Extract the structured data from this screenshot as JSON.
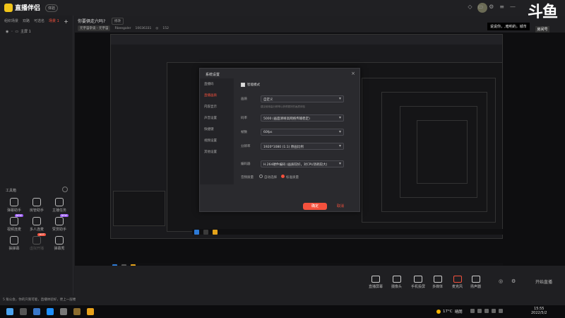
{
  "app": {
    "name": "直播伴侣",
    "version_badge": "体验"
  },
  "room": {
    "title": "你要俩走六吗?",
    "edit_label": "修改",
    "category": "元宇宙杂谈 - 元宇宙",
    "host": "Rbeegaler",
    "room_id": "10036331",
    "viewers": "152"
  },
  "left_tabs": [
    {
      "label": "组织场景"
    },
    {
      "label": "双路"
    },
    {
      "label": "可选名"
    },
    {
      "label": "场景 1"
    }
  ],
  "scene_item": "主屏 1",
  "tools": {
    "title": "工具箱",
    "items": [
      {
        "label": "弹幕助手",
        "badge": ""
      },
      {
        "label": "房管助手",
        "badge": ""
      },
      {
        "label": "主播任务",
        "badge": ""
      },
      {
        "label": "视频连麦",
        "badge": "NEW"
      },
      {
        "label": "多人连麦",
        "badge": ""
      },
      {
        "label": "赞赏助手",
        "badge": "NEW"
      },
      {
        "label": "抽弹幕",
        "badge": ""
      },
      {
        "label": "虚拟开播",
        "badge": "HOT"
      },
      {
        "label": "弹幕秀",
        "badge": ""
      }
    ]
  },
  "notice": "说说你，,暗响的，城市",
  "brand": {
    "logo_text": "斗鱼",
    "sub": "房间号",
    "number": "10036331"
  },
  "dialog": {
    "title": "系统设置",
    "nav": [
      {
        "label": "直播码"
      },
      {
        "label": "直播画质"
      },
      {
        "label": "内容显示"
      },
      {
        "label": "声音设置"
      },
      {
        "label": "快捷键"
      },
      {
        "label": "视频设置"
      },
      {
        "label": "其他设置"
      }
    ],
    "smart_mode": "智能模式",
    "rows": [
      {
        "label": "画质",
        "value": "自定义"
      },
      {
        "label": "码率",
        "value": "5000 (画面清晰高网络传输稳定)"
      },
      {
        "label": "帧数",
        "value": "60fps"
      },
      {
        "label": "分辨率",
        "value": "1920*1080 (1:1) 原画比例"
      },
      {
        "label": "编码器",
        "value": "H.264硬件编码 (画质较好，对CPU消耗较大)"
      }
    ],
    "hint": "建议使用高分辨率以获得更好的画质体验",
    "radio_label": "音频质量",
    "radio_options": [
      "自动选择",
      "标准质量"
    ],
    "ok": "确定",
    "cancel": "取消"
  },
  "bottom_controls": [
    {
      "label": "直播屏幕"
    },
    {
      "label": "摄像头"
    },
    {
      "label": "手机投屏"
    },
    {
      "label": "多媒体"
    },
    {
      "label": "麦克风"
    },
    {
      "label": "扬声器"
    }
  ],
  "start_button": "开始直播",
  "status_line": "5 角公会，你的只限可能，直播体验好，更上一层楼",
  "weather": {
    "temp": "17°C",
    "desc": "晴朗"
  },
  "clock": {
    "time": "15:55",
    "date": "2022/5/2"
  }
}
